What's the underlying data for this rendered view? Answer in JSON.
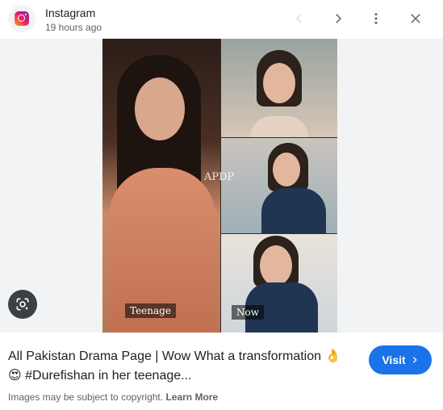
{
  "header": {
    "source_name": "Instagram",
    "time_ago": "19 hours ago",
    "icons": {
      "source_logo": "instagram-icon",
      "prev": "chevron-left-icon",
      "next": "chevron-right-icon",
      "more": "more-vert-icon",
      "close": "close-icon"
    }
  },
  "image": {
    "labels": {
      "left": "Teenage",
      "right": "Now"
    },
    "watermark": "APDP",
    "lens_icon": "google-lens-icon"
  },
  "result": {
    "title": "All Pakistan Drama Page | Wow What a transformation 👌 😍 #Durefishan in her teenage...",
    "visit_label": "Visit",
    "visit_icon": "chevron-right-icon",
    "copyright_text": "Images may be subject to copyright.",
    "learn_more": "Learn More"
  },
  "colors": {
    "accent": "#1a73e8",
    "image_bg": "#f1f3f4",
    "secondary_text": "#5f6368"
  }
}
